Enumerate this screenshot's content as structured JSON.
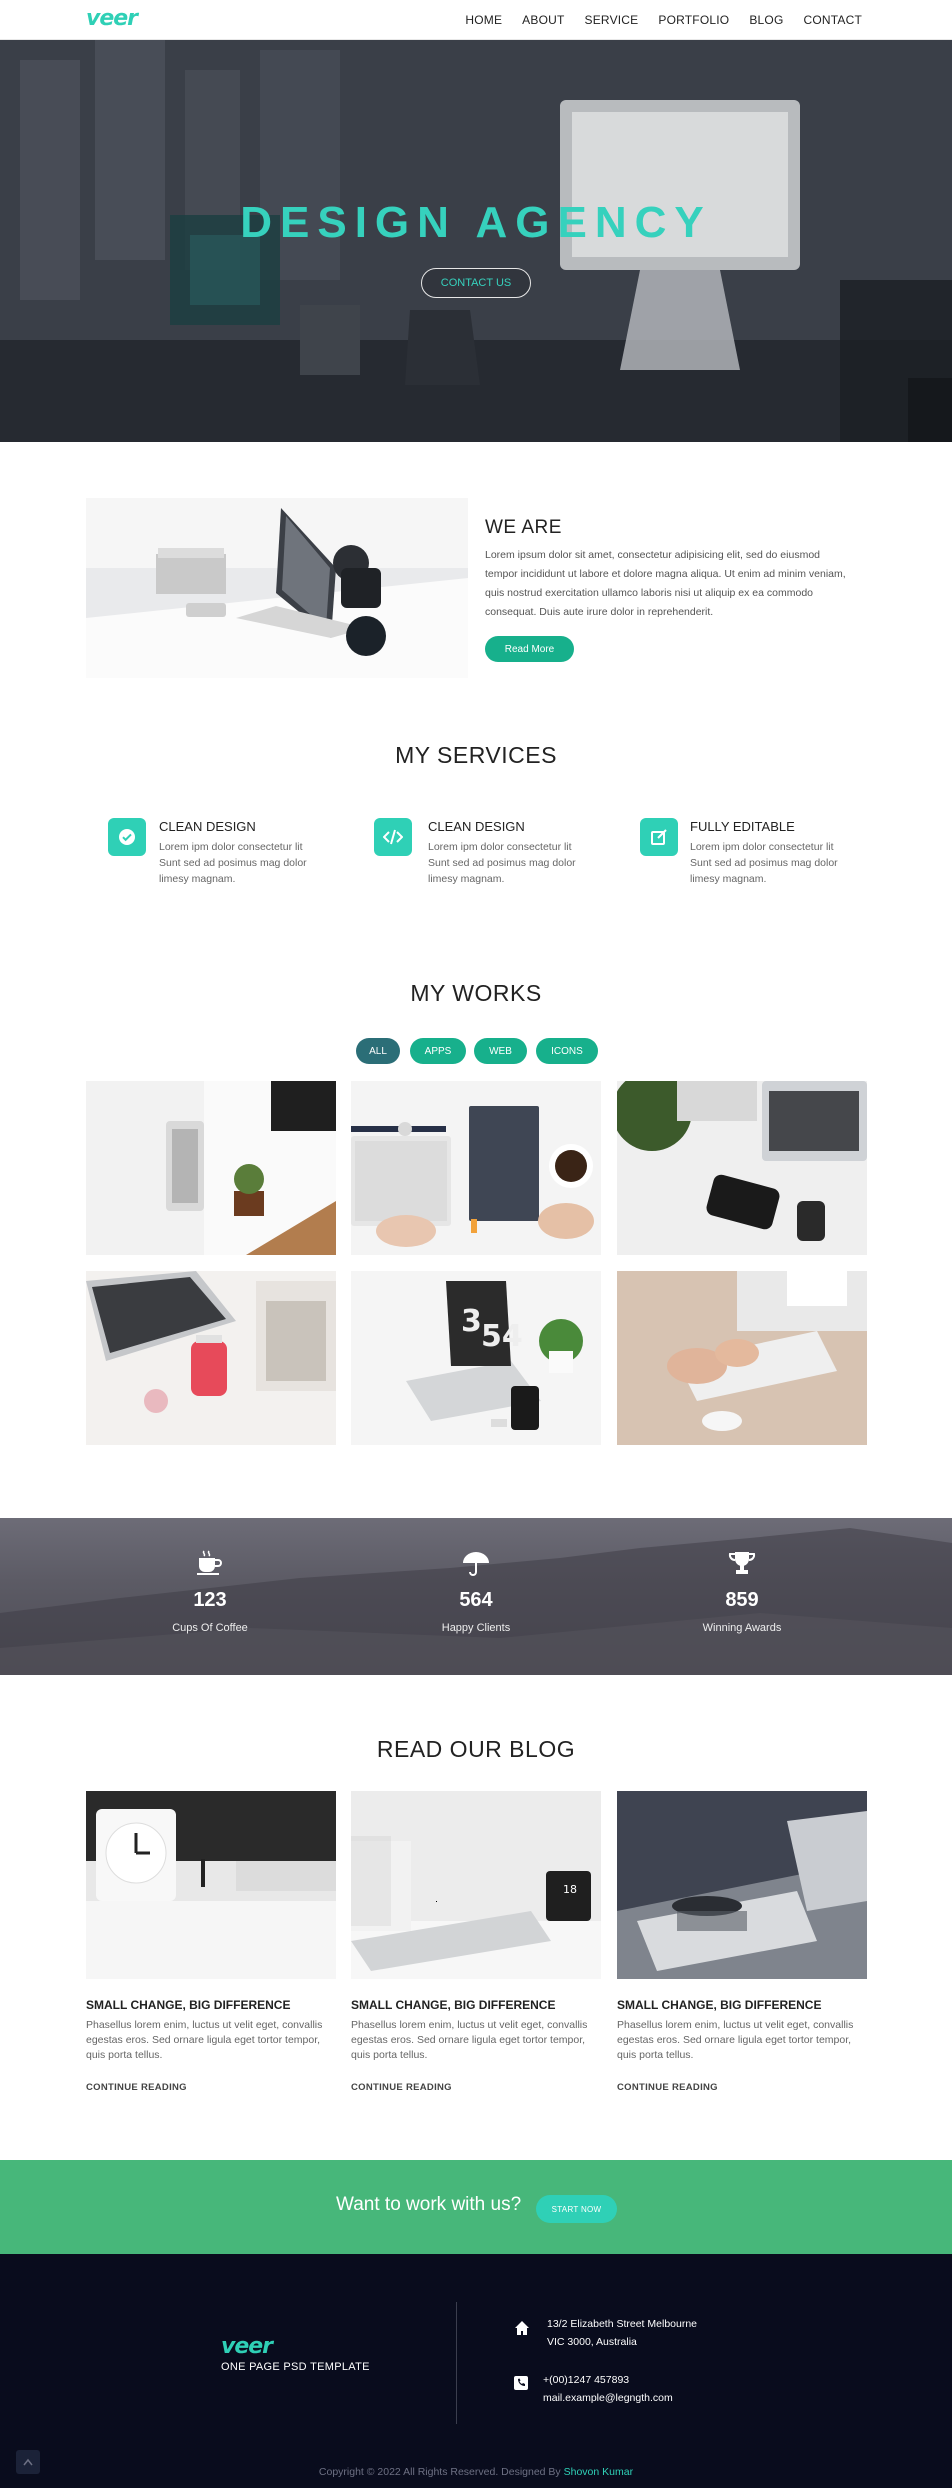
{
  "brand": {
    "logo": "veer",
    "accent": "#2fd0b6",
    "green": "#17b08c"
  },
  "nav": {
    "items": [
      "HOME",
      "ABOUT",
      "SERVICE",
      "PORTFOLIO",
      "BLOG",
      "CONTACT"
    ]
  },
  "hero": {
    "title": "DESIGN AGENCY",
    "button": "CONTACT US"
  },
  "about": {
    "title": "WE ARE",
    "text": "Lorem ipsum dolor sit amet, consectetur adipisicing elit, sed do eiusmod tempor incididunt ut labore et dolore magna aliqua. Ut enim ad minim veniam, quis nostrud exercitation ullamco laboris nisi ut aliquip ex ea commodo consequat. Duis aute irure dolor in reprehenderit.",
    "button": "Read More"
  },
  "services": {
    "title": "MY SERVICES",
    "items": [
      {
        "icon": "check-circle-icon",
        "title": "CLEAN DESIGN",
        "text": "Lorem ipm dolor consectetur lit Sunt sed ad posimus mag dolor limesy magnam."
      },
      {
        "icon": "code-icon",
        "title": "CLEAN DESIGN",
        "text": "Lorem ipm dolor consectetur lit Sunt sed ad posimus mag dolor limesy magnam."
      },
      {
        "icon": "edit-icon",
        "title": "FULLY EDITABLE",
        "text": "Lorem ipm dolor consectetur lit Sunt sed ad posimus mag dolor limesy magnam."
      }
    ]
  },
  "works": {
    "title": "MY WORKS",
    "filters": [
      "ALL",
      "APPS",
      "WEB",
      "ICONS"
    ],
    "active_filter": "ALL"
  },
  "stats": [
    {
      "icon": "coffee-icon",
      "value": "123",
      "label": "Cups Of Coffee"
    },
    {
      "icon": "umbrella-icon",
      "value": "564",
      "label": "Happy Clients"
    },
    {
      "icon": "trophy-icon",
      "value": "859",
      "label": "Winning Awards"
    }
  ],
  "blog": {
    "title": "READ OUR BLOG",
    "posts": [
      {
        "title": "SMALL CHANGE, BIG DIFFERENCE",
        "text": "Phasellus lorem enim, luctus ut velit eget, convallis egestas eros. Sed ornare ligula eget tortor tempor, quis porta tellus.",
        "link": "CONTINUE READING"
      },
      {
        "title": "SMALL CHANGE, BIG DIFFERENCE",
        "text": "Phasellus lorem enim, luctus ut velit eget, convallis egestas eros. Sed ornare ligula eget tortor tempor, quis porta tellus.",
        "link": "CONTINUE READING"
      },
      {
        "title": "SMALL CHANGE, BIG DIFFERENCE",
        "text": "Phasellus lorem enim, luctus ut velit eget, convallis egestas eros. Sed ornare ligula eget tortor tempor, quis porta tellus.",
        "link": "CONTINUE READING"
      }
    ],
    "clock_number": "18"
  },
  "cta": {
    "text": "Want to work with us?",
    "button": "START NOW"
  },
  "footer": {
    "logo": "veer",
    "subtitle": "ONE PAGE PSD TEMPLATE",
    "address_line1": "13/2 Elizabeth Street Melbourne",
    "address_line2": "VIC 3000, Australia",
    "phone": "+(00)1247 457893",
    "email": "mail.example@legngth.com",
    "copyright": "Copyright © 2022 All Rights Reserved. Designed By",
    "designer": "Shovon Kumar"
  }
}
